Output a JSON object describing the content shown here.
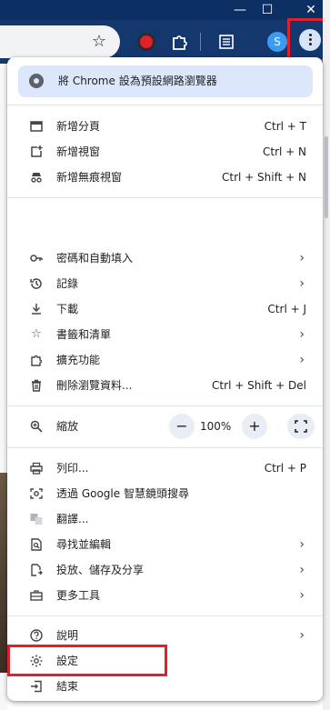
{
  "window": {
    "minimize_glyph": "—",
    "maximize_glyph": "☐",
    "close_glyph": "✕"
  },
  "toolbar": {
    "bookmark_icon": "star-icon",
    "extension_badge": "S"
  },
  "menu": {
    "banner": "將 Chrome 設為預設網路瀏覽器",
    "items": [
      {
        "label": "新增分頁",
        "shortcut": "Ctrl + T"
      },
      {
        "label": "新增視窗",
        "shortcut": "Ctrl + N"
      },
      {
        "label": "新增無痕視窗",
        "shortcut": "Ctrl + Shift + N"
      },
      {
        "label": "密碼和自動填入",
        "shortcut": ""
      },
      {
        "label": "記錄",
        "shortcut": ""
      },
      {
        "label": "下載",
        "shortcut": "Ctrl + J"
      },
      {
        "label": "書籤和清單",
        "shortcut": ""
      },
      {
        "label": "擴充功能",
        "shortcut": ""
      },
      {
        "label": "刪除瀏覽資料...",
        "shortcut": "Ctrl + Shift + Del"
      },
      {
        "label": "列印...",
        "shortcut": "Ctrl + P"
      },
      {
        "label": "透過 Google 智慧鏡頭搜尋",
        "shortcut": ""
      },
      {
        "label": "翻譯...",
        "shortcut": ""
      },
      {
        "label": "尋找並編輯",
        "shortcut": ""
      },
      {
        "label": "投放、儲存及分享",
        "shortcut": ""
      },
      {
        "label": "更多工具",
        "shortcut": ""
      },
      {
        "label": "說明",
        "shortcut": ""
      },
      {
        "label": "設定",
        "shortcut": ""
      },
      {
        "label": "結束",
        "shortcut": ""
      }
    ],
    "zoom": {
      "label": "縮放",
      "minus": "−",
      "value": "100%",
      "plus": "+"
    }
  },
  "colors": {
    "accent_highlight": "#e0202c",
    "banner_bg": "#dce7fb",
    "toolbar_bg": "#14386d"
  }
}
